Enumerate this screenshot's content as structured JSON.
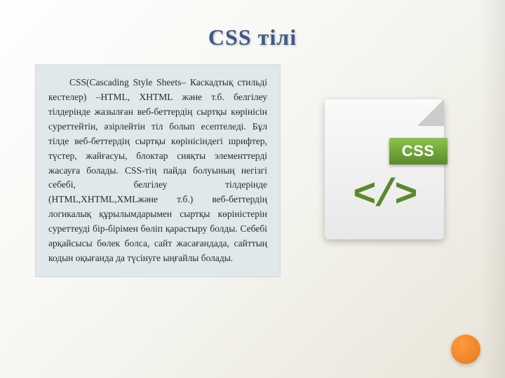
{
  "title": "CSS тілі",
  "body_text": "CSS(Cascading Style Sheets– Каскадтық стильді кестелер) –HTML, XHTML және т.б. белгілеу тілдерінде жазылған веб-беттердің сыртқы көрінісін суреттейтін, әзірлейтін тіл болып есептеледі. Бұл тілде веб-беттердің сыртқы көрінісіндегі шрифтер, түстер, жайғасуы, блоктар сияқты элементтерді жасауға болады. CSS-тің пайда болуының негізгі себебі, белгілеу тілдерінде (HTML,XHTML,XMLжәне т.б.) веб-беттердің логикалық құрылымдарымен сыртқы көріністерін суреттеуді бір-бірімен бөліп қарастыру болды. Себебі әрқайсысы бөлек болса, сайт жасағандада, сайттың кодын оқығанда да түсінуге ыңғайлы болады.",
  "badge_label": "CSS",
  "code_glyph": "</>"
}
